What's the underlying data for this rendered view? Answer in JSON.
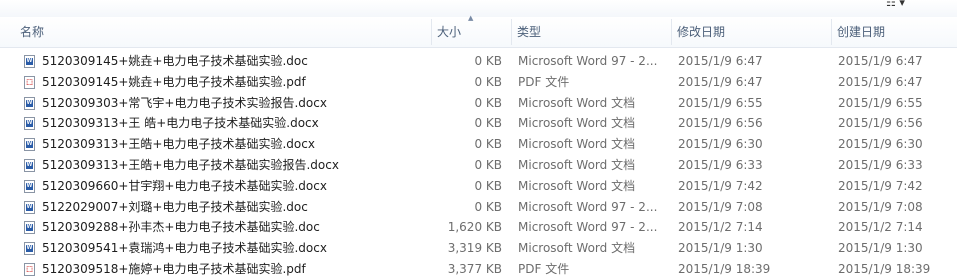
{
  "headers": {
    "name": "名称",
    "size": "大小",
    "type": "类型",
    "modified": "修改日期",
    "created": "创建日期"
  },
  "top_controls": {
    "view_menu": "☷ ▾",
    "sort_arrow": "˄"
  },
  "files": [
    {
      "icon": "word-doc-icon",
      "name": "5120309145+姚垚+电力电子技术基础实验.doc",
      "size": "0 KB",
      "type": "Microsoft Word 97 - 2...",
      "modified": "2015/1/9 6:47",
      "created": "2015/1/9 6:47"
    },
    {
      "icon": "pdf-file-icon",
      "name": "5120309145+姚垚+电力电子技术基础实验.pdf",
      "size": "0 KB",
      "type": "PDF 文件",
      "modified": "2015/1/9 6:47",
      "created": "2015/1/9 6:47"
    },
    {
      "icon": "word-doc-icon",
      "name": "5120309303+常飞宇+电力电子技术实验报告.docx",
      "size": "0 KB",
      "type": "Microsoft Word 文档",
      "modified": "2015/1/9 6:55",
      "created": "2015/1/9 6:55"
    },
    {
      "icon": "word-doc-icon",
      "name": "5120309313+王 皓+电力电子技术基础实验.docx",
      "size": "0 KB",
      "type": "Microsoft Word 文档",
      "modified": "2015/1/9 6:56",
      "created": "2015/1/9 6:56"
    },
    {
      "icon": "word-doc-icon",
      "name": "5120309313+王皓+电力电子技术基础实验.docx",
      "size": "0 KB",
      "type": "Microsoft Word 文档",
      "modified": "2015/1/9 6:30",
      "created": "2015/1/9 6:30"
    },
    {
      "icon": "word-doc-icon",
      "name": "5120309313+王皓+电力电子技术基础实验报告.docx",
      "size": "0 KB",
      "type": "Microsoft Word 文档",
      "modified": "2015/1/9 6:33",
      "created": "2015/1/9 6:33"
    },
    {
      "icon": "word-doc-icon",
      "name": "5120309660+甘宇翔+电力电子技术基础实验.docx",
      "size": "0 KB",
      "type": "Microsoft Word 文档",
      "modified": "2015/1/9 7:42",
      "created": "2015/1/9 7:42"
    },
    {
      "icon": "word-doc-icon",
      "name": "5122029007+刘璐+电力电子技术基础实验.doc",
      "size": "0 KB",
      "type": "Microsoft Word 97 - 2...",
      "modified": "2015/1/9 7:08",
      "created": "2015/1/9 7:08"
    },
    {
      "icon": "word-doc-icon",
      "name": "5120309288+孙丰杰+电力电子技术基础实验.doc",
      "size": "1,620 KB",
      "type": "Microsoft Word 97 - 2...",
      "modified": "2015/1/2 7:14",
      "created": "2015/1/2 7:14"
    },
    {
      "icon": "word-doc-icon",
      "name": "5120309541+袁瑞鸿+电力电子技术基础实验.docx",
      "size": "3,319 KB",
      "type": "Microsoft Word 文档",
      "modified": "2015/1/9 1:30",
      "created": "2015/1/9 1:30"
    },
    {
      "icon": "pdf-file-icon",
      "name": "5120309518+施婷+电力电子技术基础实验.pdf",
      "size": "3,377 KB",
      "type": "PDF 文件",
      "modified": "2015/1/9 18:39",
      "created": "2015/1/9 18:39"
    }
  ]
}
